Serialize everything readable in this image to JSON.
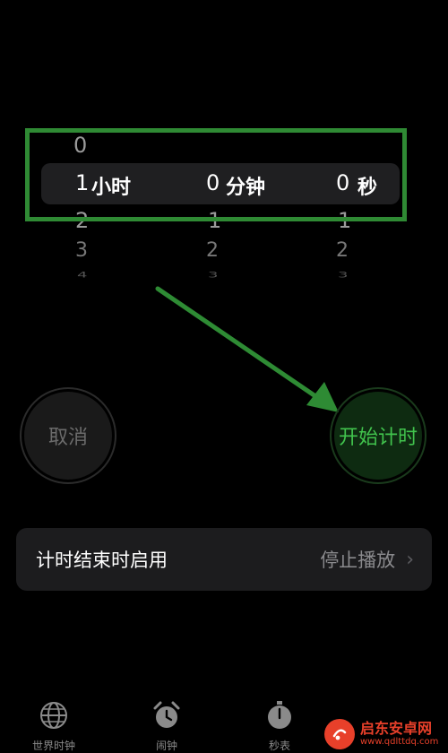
{
  "picker": {
    "hours": {
      "above": "0",
      "selected": "1",
      "below": [
        "2",
        "3",
        "4"
      ],
      "unit": "小时"
    },
    "minutes": {
      "selected": "0",
      "below": [
        "1",
        "2",
        "3"
      ],
      "unit": "分钟"
    },
    "seconds": {
      "selected": "0",
      "below": [
        "1",
        "2",
        "3"
      ],
      "unit": "秒"
    }
  },
  "buttons": {
    "cancel_label": "取消",
    "start_label": "开始计时"
  },
  "setting": {
    "label": "计时结束时启用",
    "value": "停止播放"
  },
  "tabs": [
    {
      "label": "世界时钟",
      "icon": "globe-icon"
    },
    {
      "label": "闹钟",
      "icon": "alarm-clock-icon"
    },
    {
      "label": "秒表",
      "icon": "stopwatch-icon"
    }
  ],
  "watermark": {
    "title": "启东安卓网",
    "url": "www.qdlttdq.com"
  },
  "colors": {
    "highlight_frame": "#2f8a34",
    "start_text": "#41c34d",
    "start_bg": "#0e2b11",
    "arrow": "#2e8b34",
    "watermark": "#e8402a"
  }
}
